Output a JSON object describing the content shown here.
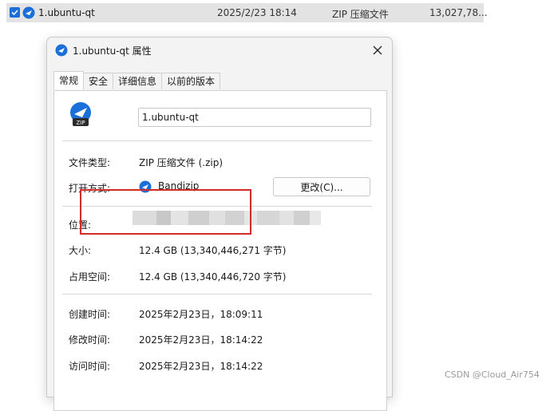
{
  "explorer_row": {
    "name": "1.ubuntu-qt",
    "date": "2025/2/23 18:14",
    "type": "ZIP 压缩文件",
    "size": "13,027,78..."
  },
  "dialog": {
    "title": "1.ubuntu-qt 属性",
    "tabs": [
      "常规",
      "安全",
      "详细信息",
      "以前的版本"
    ],
    "filename": "1.ubuntu-qt",
    "file_type_label": "文件类型:",
    "file_type_value": "ZIP 压缩文件 (.zip)",
    "open_with_label": "打开方式:",
    "open_with_value": "Bandizip",
    "change_button": "更改(C)...",
    "location_label": "位置:",
    "size_label": "大小:",
    "size_value": "12.4 GB (13,340,446,271 字节)",
    "size_on_disk_label": "占用空间:",
    "size_on_disk_value": "12.4 GB (13,340,446,720 字节)",
    "created_label": "创建时间:",
    "created_value": "2025年2月23日，18:09:11",
    "modified_label": "修改时间:",
    "modified_value": "2025年2月23日，18:14:22",
    "accessed_label": "访问时间:",
    "accessed_value": "2025年2月23日，18:14:22"
  },
  "icons": {
    "bandizip": "bandizip-icon",
    "zip_file": "zip-file-icon",
    "close": "close-icon",
    "checkbox": "checkbox-checked-icon"
  },
  "colors": {
    "accent_blue": "#1b6fd8",
    "highlight_red": "#d42a2a",
    "dialog_bg": "#f3f3f3"
  },
  "watermark": "CSDN @Cloud_Air754"
}
